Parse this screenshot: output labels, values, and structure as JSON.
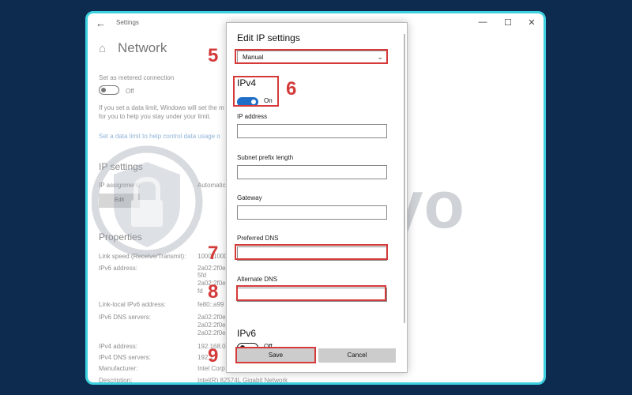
{
  "window": {
    "title": "Settings",
    "controls": {
      "minimize": "—",
      "maximize": "☐",
      "close": "✕"
    }
  },
  "background": {
    "page_title": "Network",
    "metered_label": "Set as metered connection",
    "metered_value": "Off",
    "data_limit_text_1": "If you set a data limit, Windows will set the m",
    "data_limit_text_2": "for you to help you stay under your limit.",
    "data_limit_link": "Set a data limit to help control data usage o",
    "ip_settings_heading": "IP settings",
    "ip_assignment_label": "IP assignment:",
    "ip_assignment_value": "Automatic",
    "edit_label": "Edit",
    "properties_heading": "Properties",
    "properties": [
      {
        "label": "Link speed (Receive/Transmit):",
        "value": "1000/1000"
      },
      {
        "label": "IPv6 address:",
        "value": "2a02:2f0e"
      },
      {
        "label": "",
        "value": "5fd"
      },
      {
        "label": "",
        "value": "2a02:2f0e"
      },
      {
        "label": "",
        "value": "fd"
      },
      {
        "label": "Link-local IPv6 address:",
        "value": "fe80::a99"
      },
      {
        "label": "IPv6 DNS servers:",
        "value": "2a02:2f0e"
      },
      {
        "label": "",
        "value": "2a02:2f0e"
      },
      {
        "label": "",
        "value": "2a02:2f0e"
      },
      {
        "label": "IPv4 address:",
        "value": "192.168.0"
      },
      {
        "label": "IPv4 DNS servers:",
        "value": "192.1"
      },
      {
        "label": "Manufacturer:",
        "value": "Intel Corp"
      },
      {
        "label": "Description:",
        "value": "Intel(R) 82574L Gigabit Network"
      }
    ]
  },
  "dialog": {
    "title": "Edit IP settings",
    "mode": "Manual",
    "ipv4_heading": "IPv4",
    "ipv4_toggle": "On",
    "fields": [
      {
        "label": "IP address",
        "value": ""
      },
      {
        "label": "Subnet prefix length",
        "value": ""
      },
      {
        "label": "Gateway",
        "value": ""
      },
      {
        "label": "Preferred DNS",
        "value": ""
      },
      {
        "label": "Alternate DNS",
        "value": ""
      }
    ],
    "ipv6_heading": "IPv6",
    "ipv6_toggle": "Off",
    "save_label": "Save",
    "cancel_label": "Cancel"
  },
  "steps": [
    "5",
    "6",
    "7",
    "8",
    "9"
  ],
  "watermark": "Safelyo",
  "colors": {
    "frame": "#3dd1e0",
    "page_bg": "#0d2b4e",
    "highlight": "#d43a3a",
    "toggle_on": "#1f6fc8"
  }
}
